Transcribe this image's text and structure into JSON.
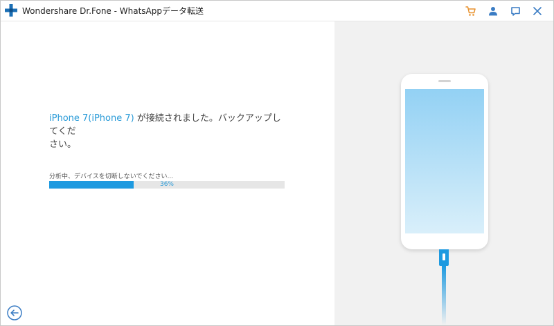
{
  "window": {
    "title": "Wondershare Dr.Fone - WhatsAppデータ転送"
  },
  "titlebar": {
    "icons": [
      "cart-icon",
      "account-icon",
      "feedback-icon",
      "close-icon"
    ]
  },
  "colors": {
    "accent": "#1e9ae0",
    "link_text": "#2a9bd8",
    "logo_blue": "#1b6fb5",
    "titlebar_icon": "#3a7cc4",
    "cart_icon": "#e8912d"
  },
  "status": {
    "device_name": "iPhone 7(iPhone 7)",
    "message_line1": " が接続されました。バックアップしてくだ",
    "message_line2": "さい。",
    "analyzing_text": "分析中、デバイスを切断しないでください...",
    "progress_label": "36%",
    "progress_value": 36
  },
  "navigation": {
    "back_icon": "back-arrow-icon"
  }
}
